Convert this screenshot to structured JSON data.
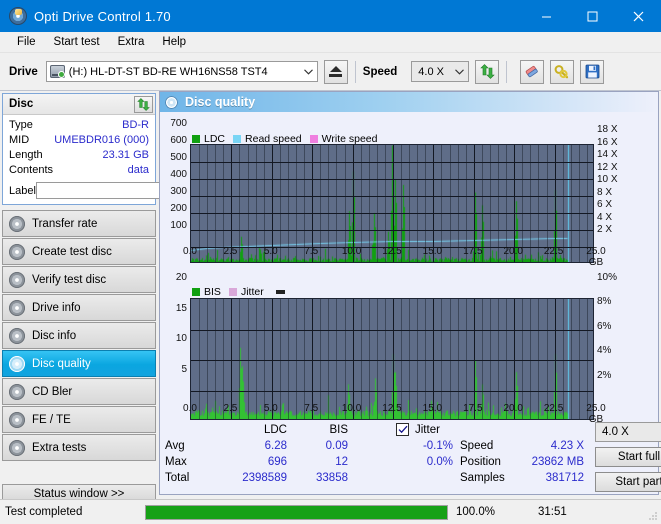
{
  "window": {
    "title": "Opti Drive Control 1.70",
    "icon": "disc-icon",
    "minimize": "minimize-icon",
    "maximize": "maximize-icon",
    "close": "close-icon"
  },
  "menu": {
    "items": [
      {
        "label": "File"
      },
      {
        "label": "Start test"
      },
      {
        "label": "Extra"
      },
      {
        "label": "Help"
      }
    ]
  },
  "toolbar": {
    "drive_label": "Drive",
    "drive_value": "(H:)   HL-DT-ST BD-RE  WH16NS58 TST4",
    "eject_icon": "eject-icon",
    "speed_label": "Speed",
    "speed_value": "4.0 X",
    "refresh_icon": "refresh-icon",
    "erase_icon": "eraser-icon",
    "tools_icon": "tools-icon",
    "save_icon": "save-icon"
  },
  "disc_panel": {
    "title": "Disc",
    "refresh_icon": "refresh-icon",
    "rows": [
      {
        "key": "Type",
        "value": "BD-R"
      },
      {
        "key": "MID",
        "value": "UMEBDR016 (000)"
      },
      {
        "key": "Length",
        "value": "23.31 GB"
      },
      {
        "key": "Contents",
        "value": "data"
      }
    ],
    "label_key": "Label",
    "label_value": "",
    "label_placeholder": "",
    "disc_button_icon": "cd-icon"
  },
  "sidebar": {
    "items": [
      {
        "label": "Transfer rate",
        "active": false
      },
      {
        "label": "Create test disc",
        "active": false
      },
      {
        "label": "Verify test disc",
        "active": false
      },
      {
        "label": "Drive info",
        "active": false
      },
      {
        "label": "Disc info",
        "active": false
      },
      {
        "label": "Disc quality",
        "active": true
      },
      {
        "label": "CD Bler",
        "active": false
      },
      {
        "label": "FE / TE",
        "active": false
      },
      {
        "label": "Extra tests",
        "active": false
      }
    ],
    "status_window": "Status window >>"
  },
  "main": {
    "header": "Disc quality",
    "header_icon": "disc-quality-icon"
  },
  "chart_data": [
    {
      "type": "line",
      "title": "LDC / Read speed",
      "xlabel": "GB",
      "ylabel": "LDC",
      "grid": true,
      "legend_position": "top-left",
      "legend": [
        {
          "label": "LDC",
          "color": "#11a011"
        },
        {
          "label": "Read speed",
          "color": "#79d5f5"
        },
        {
          "label": "Write speed",
          "color": "#ef7fe0"
        }
      ],
      "x": [
        0.0,
        2.5,
        5.0,
        7.5,
        10.0,
        12.5,
        15.0,
        17.5,
        20.0,
        22.5,
        25.0
      ],
      "xtick_labels": [
        "0.0",
        "2.5",
        "5.0",
        "7.5",
        "10.0",
        "12.5",
        "15.0",
        "17.5",
        "20.0",
        "22.5",
        "25.0 GB"
      ],
      "xlim": [
        0.0,
        25.0
      ],
      "ytick_labels": [
        "100",
        "200",
        "300",
        "400",
        "500",
        "600",
        "700"
      ],
      "yticks": [
        100,
        200,
        300,
        400,
        500,
        600,
        700
      ],
      "ylim": [
        0,
        700
      ],
      "y2tick_labels": [
        "2 X",
        "4 X",
        "6 X",
        "8 X",
        "10 X",
        "12 X",
        "14 X",
        "16 X",
        "18 X"
      ],
      "y2ticks": [
        2,
        4,
        6,
        8,
        10,
        12,
        14,
        16,
        18
      ],
      "y2lim": [
        0,
        19
      ],
      "series": [
        {
          "name": "LDC",
          "color": "#11a011",
          "type": "bar",
          "note": "dense green spike field, baseline ~15-40, major spikes noted below",
          "peaks": [
            {
              "x": 3.1,
              "y": 160
            },
            {
              "x": 4.3,
              "y": 85
            },
            {
              "x": 9.8,
              "y": 310
            },
            {
              "x": 10.05,
              "y": 545
            },
            {
              "x": 11.3,
              "y": 300
            },
            {
              "x": 12.2,
              "y": 190
            },
            {
              "x": 12.45,
              "y": 696
            },
            {
              "x": 12.6,
              "y": 500
            },
            {
              "x": 13.1,
              "y": 465
            },
            {
              "x": 17.6,
              "y": 420
            },
            {
              "x": 18.0,
              "y": 345
            },
            {
              "x": 20.1,
              "y": 370
            },
            {
              "x": 22.55,
              "y": 435
            }
          ]
        },
        {
          "name": "Read speed",
          "color": "#79d5f5",
          "type": "line",
          "note": "CAV-ish staircase on secondary X axis",
          "points": [
            {
              "x": 0.0,
              "y": 2.3
            },
            {
              "x": 1.0,
              "y": 2.5
            },
            {
              "x": 2.0,
              "y": 2.7
            },
            {
              "x": 3.5,
              "y": 2.9
            },
            {
              "x": 5.0,
              "y": 3.1
            },
            {
              "x": 6.5,
              "y": 3.2
            },
            {
              "x": 8.0,
              "y": 3.3
            },
            {
              "x": 10.0,
              "y": 3.45
            },
            {
              "x": 12.5,
              "y": 3.6
            },
            {
              "x": 15.0,
              "y": 3.75
            },
            {
              "x": 17.5,
              "y": 3.85
            },
            {
              "x": 20.0,
              "y": 4.0
            },
            {
              "x": 22.5,
              "y": 4.1
            },
            {
              "x": 23.3,
              "y": 4.15
            }
          ]
        },
        {
          "name": "Write speed",
          "color": "#ef7fe0",
          "type": "line",
          "points": []
        },
        {
          "name": "End marker",
          "color": "#5fd0f5",
          "type": "vline",
          "x": 23.35
        }
      ]
    },
    {
      "type": "bar",
      "title": "BIS / Jitter",
      "xlabel": "GB",
      "ylabel": "BIS",
      "grid": true,
      "legend_position": "top-left",
      "legend": [
        {
          "label": "BIS",
          "color": "#11a011"
        },
        {
          "label": "Jitter",
          "color": "#d9a8d9"
        }
      ],
      "xtick_labels": [
        "0.0",
        "2.5",
        "5.0",
        "7.5",
        "10.0",
        "12.5",
        "15.0",
        "17.5",
        "20.0",
        "22.5",
        "25.0 GB"
      ],
      "xlim": [
        0.0,
        25.0
      ],
      "ytick_labels": [
        "5",
        "10",
        "15",
        "20"
      ],
      "yticks": [
        5,
        10,
        15,
        20
      ],
      "ylim": [
        0,
        20
      ],
      "y2tick_labels": [
        "2%",
        "4%",
        "6%",
        "8%",
        "10%"
      ],
      "y2ticks": [
        2,
        4,
        6,
        8,
        10
      ],
      "y2lim": [
        0,
        10
      ],
      "series": [
        {
          "name": "BIS",
          "color": "#11a011",
          "type": "bar",
          "note": "dense green field baseline ~0.8-2, spikes listed",
          "peaks": [
            {
              "x": 3.05,
              "y": 12
            },
            {
              "x": 3.15,
              "y": 9
            },
            {
              "x": 9.7,
              "y": 6
            },
            {
              "x": 11.4,
              "y": 7
            },
            {
              "x": 12.5,
              "y": 11
            },
            {
              "x": 12.65,
              "y": 8
            },
            {
              "x": 17.6,
              "y": 10
            },
            {
              "x": 18.0,
              "y": 6
            },
            {
              "x": 20.1,
              "y": 8
            },
            {
              "x": 22.55,
              "y": 11
            }
          ]
        },
        {
          "name": "Jitter",
          "color": "#d9a8d9",
          "type": "line",
          "points": []
        },
        {
          "name": "End marker",
          "color": "#5fd0f5",
          "type": "vline",
          "x": 23.35
        }
      ]
    }
  ],
  "stats": {
    "col_headers": [
      "LDC",
      "BIS"
    ],
    "rows": [
      {
        "label": "Avg",
        "ldc": "6.28",
        "bis": "0.09"
      },
      {
        "label": "Max",
        "ldc": "696",
        "bis": "12"
      },
      {
        "label": "Total",
        "ldc": "2398589",
        "bis": "33858"
      }
    ],
    "jitter_checked": true,
    "jitter_label": "Jitter",
    "jitter_values": [
      "-0.1%",
      "0.0%"
    ],
    "right_rows": [
      {
        "label": "Speed",
        "value": "4.23 X"
      },
      {
        "label": "Position",
        "value": "23862 MB"
      },
      {
        "label": "Samples",
        "value": "381712"
      }
    ],
    "speed_select": "4.0 X",
    "start_full": "Start full",
    "start_part": "Start part"
  },
  "statusbar": {
    "message": "Test completed",
    "progress_percent": 100.0,
    "progress_text": "100.0%",
    "elapsed": "31:51"
  },
  "colors": {
    "accent": "#0078d4",
    "plot_bg": "#5f6d88",
    "ldc_green": "#11a011",
    "read_speed": "#79d5f5",
    "write_speed": "#ef7fe0",
    "jitter": "#d9a8d9",
    "value_blue": "#2b2bcc",
    "progress_green": "#16a116"
  }
}
